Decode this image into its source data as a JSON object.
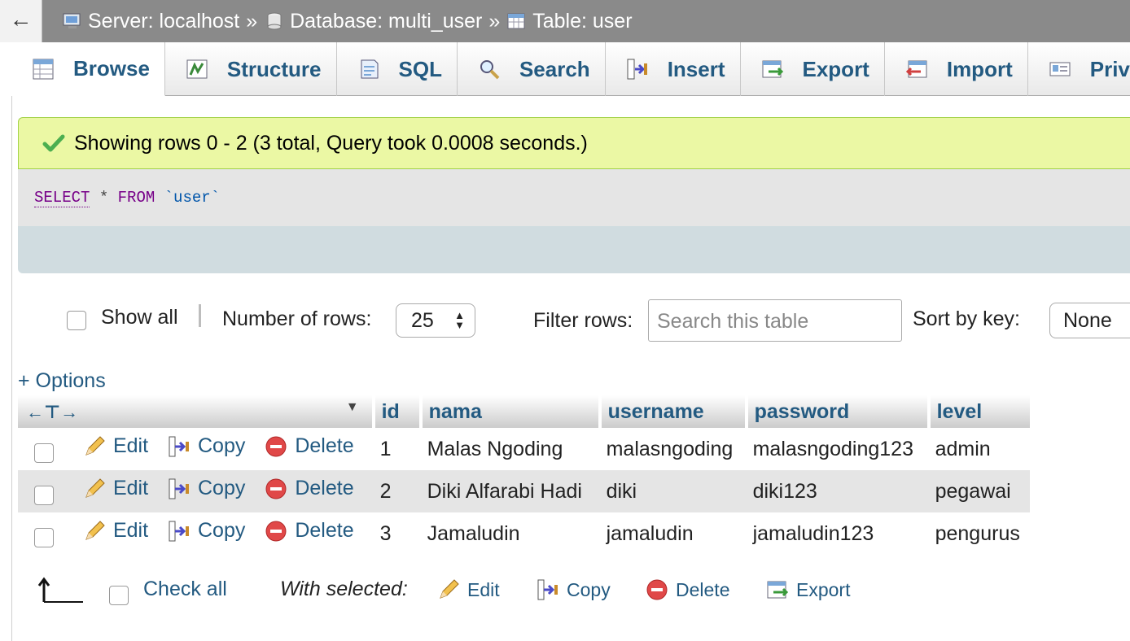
{
  "breadcrumb": {
    "server": "Server: localhost",
    "database": "Database: multi_user",
    "table": "Table: user",
    "separator": "»"
  },
  "nav": {
    "back_icon": "←"
  },
  "tabs": [
    {
      "label": "Browse",
      "icon": "browse-icon"
    },
    {
      "label": "Structure",
      "icon": "structure-icon"
    },
    {
      "label": "SQL",
      "icon": "sql-icon"
    },
    {
      "label": "Search",
      "icon": "search-icon"
    },
    {
      "label": "Insert",
      "icon": "insert-icon"
    },
    {
      "label": "Export",
      "icon": "export-icon"
    },
    {
      "label": "Import",
      "icon": "import-icon"
    },
    {
      "label": "Privi",
      "icon": "privileges-icon"
    }
  ],
  "message": {
    "text": "Showing rows 0 - 2 (3 total, Query took 0.0008 seconds.)"
  },
  "query": {
    "select": "SELECT",
    "star": " * ",
    "from": "FROM",
    "table": " `user`"
  },
  "controls": {
    "show_all": "Show all",
    "number_of_rows_label": "Number of rows:",
    "number_of_rows_value": "25",
    "filter_label": "Filter rows:",
    "filter_placeholder": "Search this table",
    "sort_label": "Sort by key:",
    "sort_value": "None"
  },
  "options_link": "+ Options",
  "table": {
    "columns": [
      "id",
      "nama",
      "username",
      "password",
      "level"
    ],
    "actions": {
      "edit": "Edit",
      "copy": "Copy",
      "delete": "Delete"
    },
    "rows": [
      {
        "id": "1",
        "nama": "Malas Ngoding",
        "username": "malasngoding",
        "password": "malasngoding123",
        "level": "admin"
      },
      {
        "id": "2",
        "nama": "Diki Alfarabi Hadi",
        "username": "diki",
        "password": "diki123",
        "level": "pegawai"
      },
      {
        "id": "3",
        "nama": "Jamaludin",
        "username": "jamaludin",
        "password": "jamaludin123",
        "level": "pengurus"
      }
    ]
  },
  "footer": {
    "check_all": "Check all",
    "with_selected": "With selected:",
    "edit": "Edit",
    "copy": "Copy",
    "delete": "Delete",
    "export": "Export"
  },
  "colors": {
    "link": "#235a81",
    "success_bg": "#ebf8a4",
    "header_bar": "#8a8a8a"
  }
}
